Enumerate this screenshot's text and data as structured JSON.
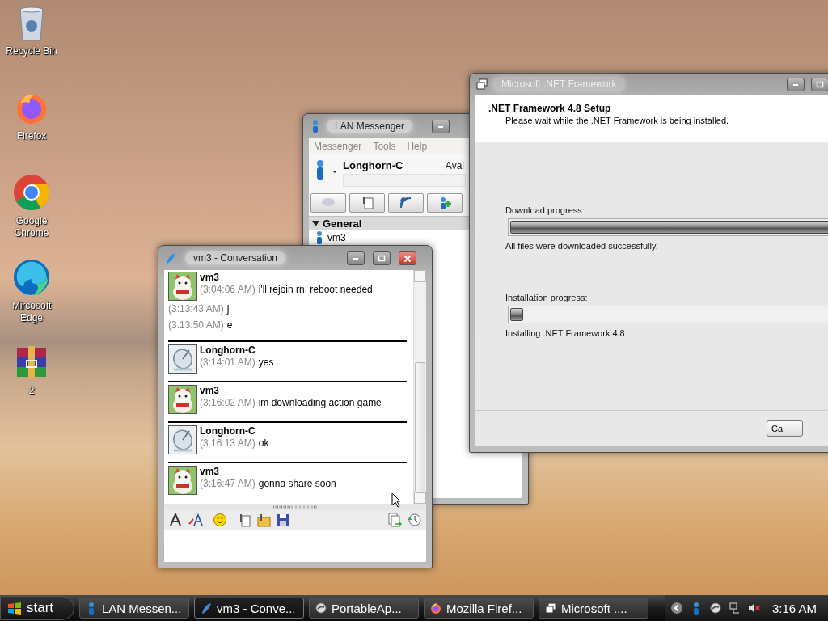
{
  "desktop_icons": [
    {
      "kind": "recycle",
      "label": "Recycle Bin"
    },
    {
      "kind": "firefox",
      "label": "Firefox"
    },
    {
      "kind": "chrome",
      "label": "Google Chrome"
    },
    {
      "kind": "edge",
      "label": "Mircosoft Edge"
    },
    {
      "kind": "archive",
      "label": "2"
    }
  ],
  "lan_messenger": {
    "title": "LAN Messenger",
    "menu": [
      "Messenger",
      "Tools",
      "Help"
    ],
    "user_name": "Longhorn-C",
    "status": "Avai",
    "group": {
      "label": "General",
      "expanded": true,
      "contacts": [
        "vm3"
      ]
    }
  },
  "setup": {
    "title": "Microsoft .NET Framework",
    "heading": ".NET Framework 4.8 Setup",
    "subheading": "Please wait while the .NET Framework is being installed.",
    "download": {
      "label": "Download progress:",
      "level": 1,
      "status": "All files were downloaded successfully."
    },
    "install": {
      "label": "Installation progress:",
      "level": 0.03,
      "status": "Installing .NET Framework 4.8"
    },
    "button": "Ca"
  },
  "conversation": {
    "title": "vm3 - Conversation",
    "messages": [
      {
        "sender": "vm3",
        "kind": "cat",
        "lines": [
          {
            "time": "(3:04:06 AM)",
            "text": "i'll rejoin rn, reboot needed"
          },
          {
            "time": "(3:13:43 AM)",
            "text": "j"
          },
          {
            "time": "(3:13:50 AM)",
            "text": "e"
          }
        ]
      },
      {
        "sender": "Longhorn-C",
        "kind": "dish",
        "lines": [
          {
            "time": "(3:14:01 AM)",
            "text": "yes"
          }
        ]
      },
      {
        "sender": "vm3",
        "kind": "cat",
        "lines": [
          {
            "time": "(3:16:02 AM)",
            "text": "im downloading action game"
          }
        ]
      },
      {
        "sender": "Longhorn-C",
        "kind": "dish",
        "lines": [
          {
            "time": "(3:16:13 AM)",
            "text": "ok"
          }
        ]
      },
      {
        "sender": "vm3",
        "kind": "cat",
        "lines": [
          {
            "time": "(3:16:47 AM)",
            "text": "gonna share soon"
          }
        ]
      }
    ]
  },
  "taskbar": {
    "start": "start",
    "tasks": [
      {
        "kind": "messenger",
        "label": "LAN Messen...",
        "selected": false
      },
      {
        "kind": "chat",
        "label": "vm3 - Conve...",
        "selected": true
      },
      {
        "kind": "portable",
        "label": "PortableAp...",
        "selected": false
      },
      {
        "kind": "firefox",
        "label": "Mozilla Firef...",
        "selected": false
      },
      {
        "kind": "window",
        "label": "Microsoft ....",
        "selected": false
      }
    ],
    "clock": "3:16 AM"
  }
}
